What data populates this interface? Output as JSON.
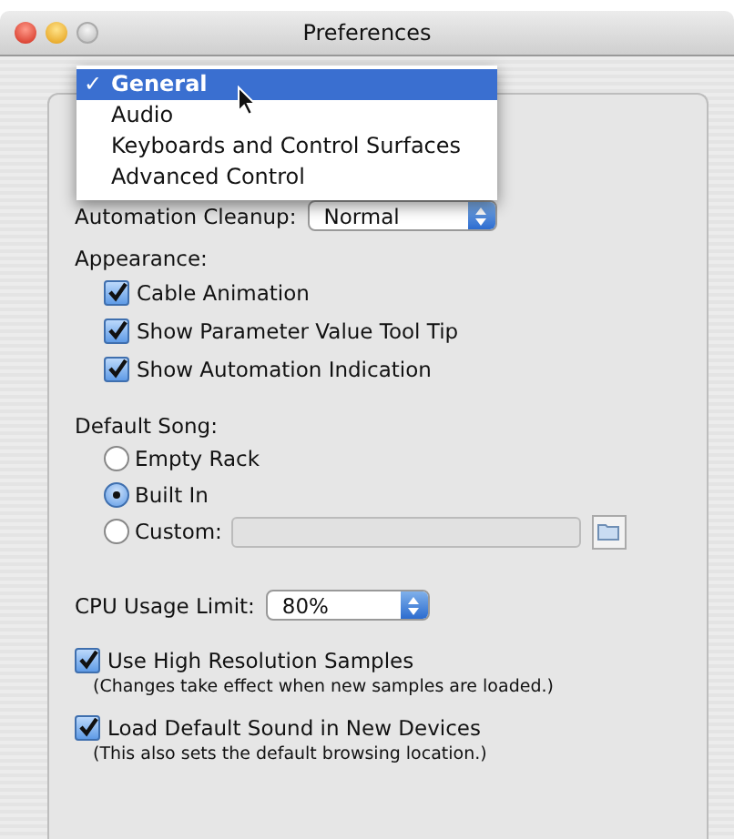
{
  "window": {
    "title": "Preferences"
  },
  "menu": {
    "check_mark": "✓",
    "items": [
      {
        "label": "General",
        "selected": true
      },
      {
        "label": "Audio",
        "selected": false
      },
      {
        "label": "Keyboards and Control Surfaces",
        "selected": false
      },
      {
        "label": "Advanced Control",
        "selected": false
      }
    ]
  },
  "automation_cleanup": {
    "label": "Automation Cleanup:",
    "value": "Normal"
  },
  "appearance": {
    "heading": "Appearance:",
    "checkboxes": [
      {
        "label": "Cable Animation",
        "checked": true
      },
      {
        "label": "Show Parameter Value Tool Tip",
        "checked": true
      },
      {
        "label": "Show Automation Indication",
        "checked": true
      }
    ]
  },
  "default_song": {
    "heading": "Default Song:",
    "options": [
      {
        "label": "Empty Rack",
        "selected": false
      },
      {
        "label": "Built In",
        "selected": true
      },
      {
        "label": "Custom:",
        "selected": false,
        "kind": "path"
      }
    ]
  },
  "cpu_usage": {
    "label": "CPU Usage Limit:",
    "value": "80%"
  },
  "options": [
    {
      "label": "Use High Resolution Samples",
      "checked": true,
      "note": "(Changes take effect when new samples are loaded.)"
    },
    {
      "label": "Load Default Sound in New Devices",
      "checked": true,
      "note": "(This also sets the default browsing location.)"
    }
  ]
}
